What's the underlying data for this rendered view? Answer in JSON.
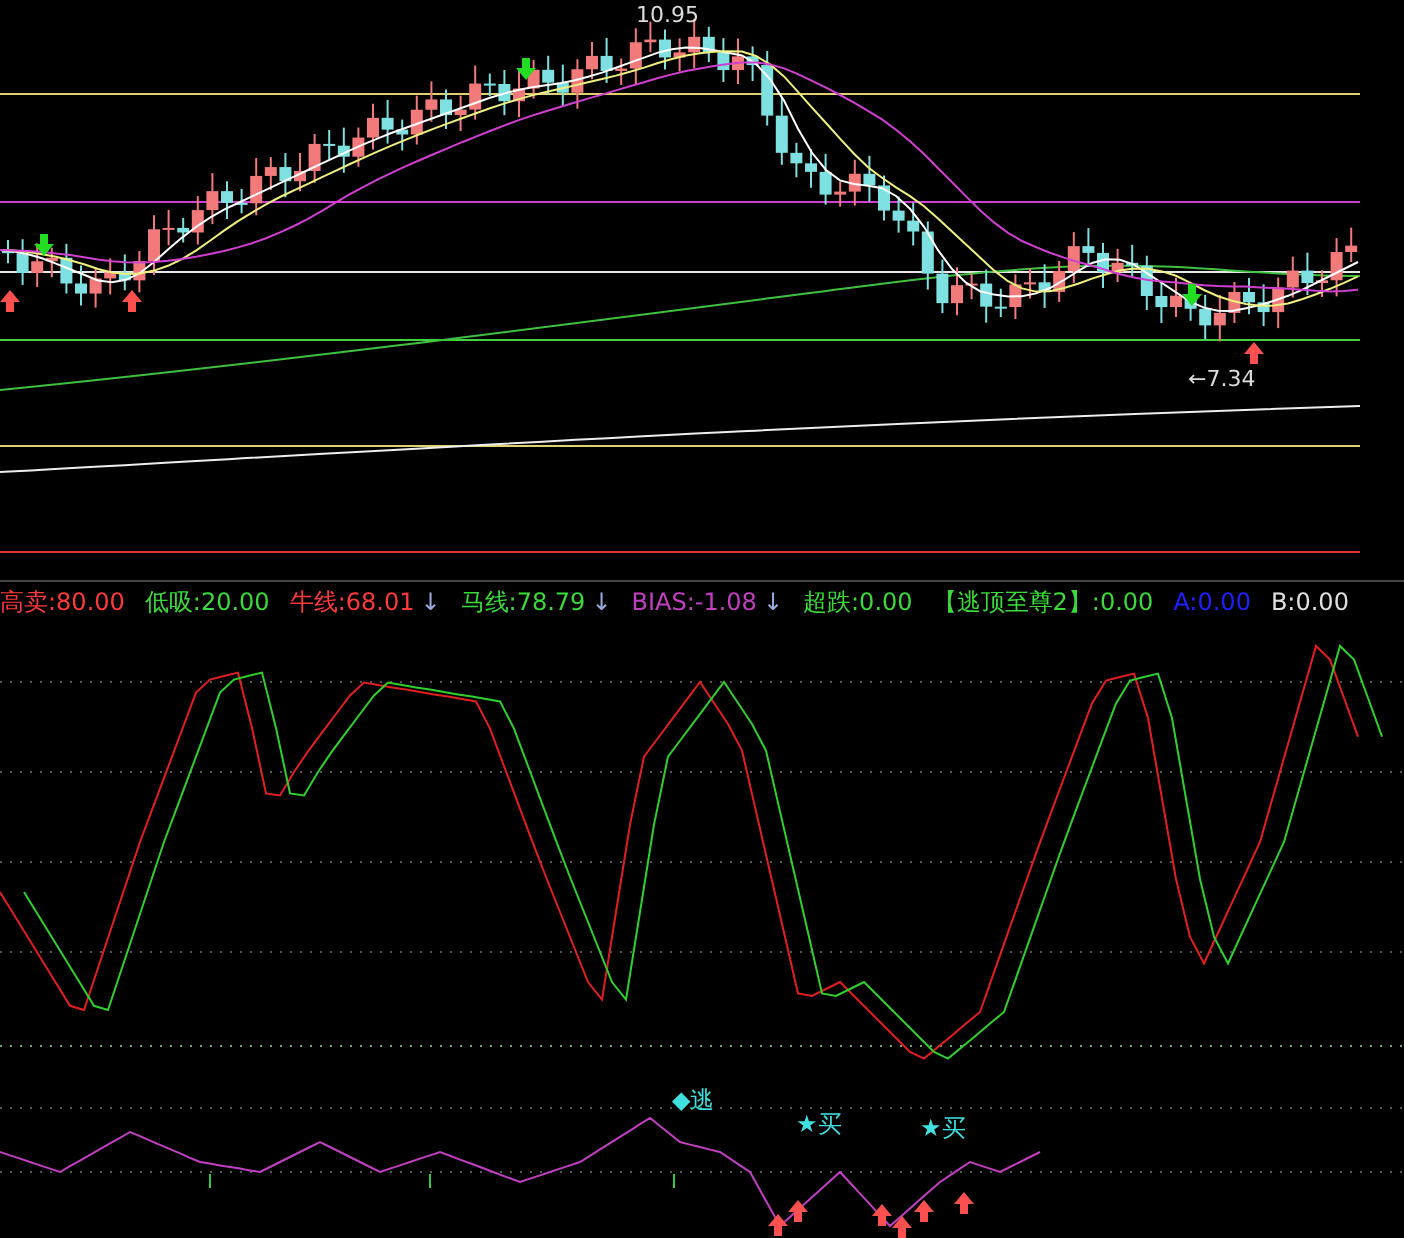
{
  "price_panel": {
    "high_label": "10.95",
    "low_label": "←7.34"
  },
  "indicator_legend": [
    {
      "text": "高卖:80.00",
      "color": "#ff3b3b"
    },
    {
      "text": "低吸:20.00",
      "color": "#3bd93b"
    },
    {
      "text": "牛线:68.01",
      "color": "#ff3b3b",
      "arrow": "↓"
    },
    {
      "text": "马线:78.79",
      "color": "#3bd93b",
      "arrow": "↓"
    },
    {
      "text": "BIAS:-1.08",
      "color": "#c040c0",
      "arrow": "↓"
    },
    {
      "text": "超跌:0.00",
      "color": "#3bd93b"
    },
    {
      "text": "【逃顶至尊2】:0.00",
      "color": "#3bd93b"
    },
    {
      "text": "A:0.00",
      "color": "#2020ff"
    },
    {
      "text": "B:0.00",
      "color": "#e0e0e0"
    }
  ],
  "signals": [
    {
      "text": "◆逃"
    },
    {
      "text": "★买"
    },
    {
      "text": "★买"
    }
  ]
}
